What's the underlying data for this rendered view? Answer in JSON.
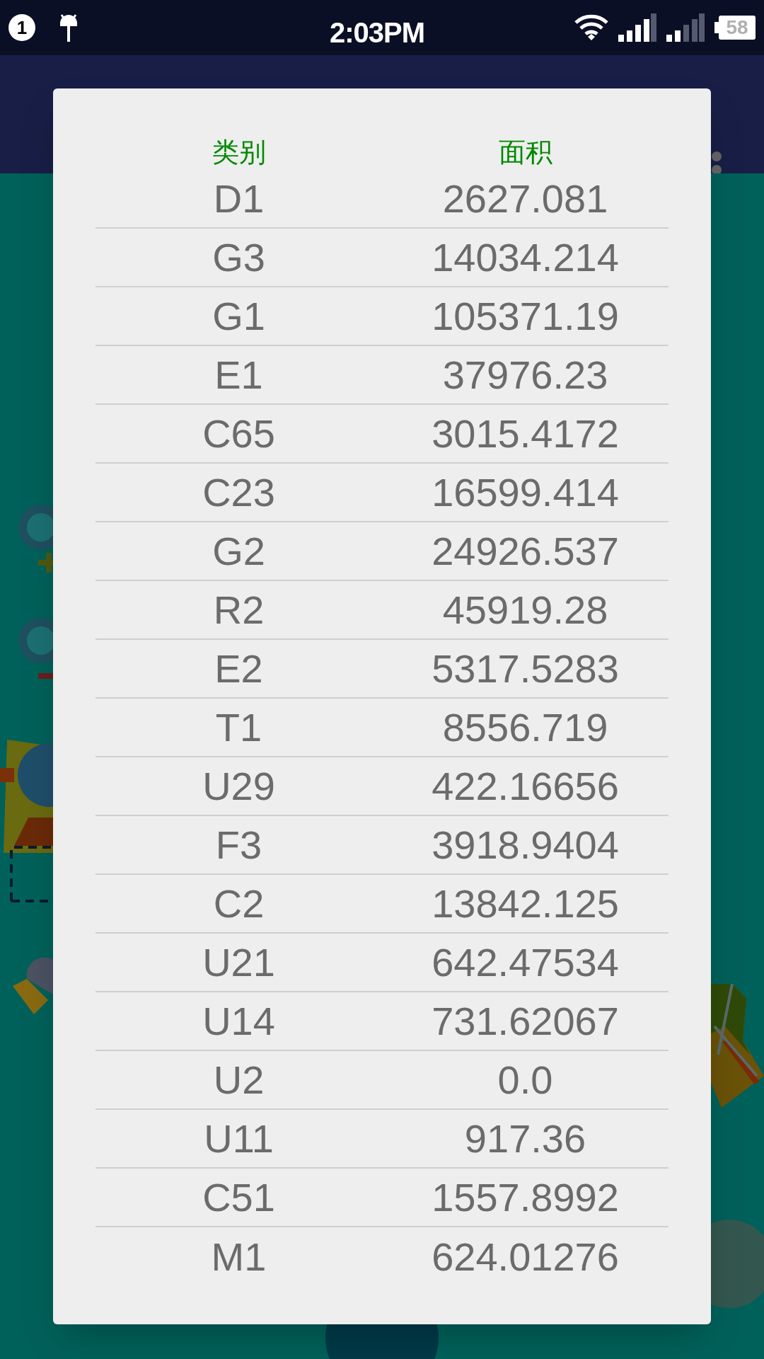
{
  "status_bar": {
    "notification_count": "1",
    "time": "2:03PM",
    "battery": "58"
  },
  "dialog": {
    "columns": [
      "类别",
      "面积"
    ],
    "rows": [
      {
        "category": "D1",
        "area": "2627.081"
      },
      {
        "category": "G3",
        "area": "14034.214"
      },
      {
        "category": "G1",
        "area": "105371.19"
      },
      {
        "category": "E1",
        "area": "37976.23"
      },
      {
        "category": "C65",
        "area": "3015.4172"
      },
      {
        "category": "C23",
        "area": "16599.414"
      },
      {
        "category": "G2",
        "area": "24926.537"
      },
      {
        "category": "R2",
        "area": "45919.28"
      },
      {
        "category": "E2",
        "area": "5317.5283"
      },
      {
        "category": "T1",
        "area": "8556.719"
      },
      {
        "category": "U29",
        "area": "422.16656"
      },
      {
        "category": "F3",
        "area": "3918.9404"
      },
      {
        "category": "C2",
        "area": "13842.125"
      },
      {
        "category": "U21",
        "area": "642.47534"
      },
      {
        "category": "U14",
        "area": "731.62067"
      },
      {
        "category": "U2",
        "area": "0.0"
      },
      {
        "category": "U11",
        "area": "917.36"
      },
      {
        "category": "C51",
        "area": "1557.8992"
      },
      {
        "category": "M1",
        "area": "624.01276"
      }
    ]
  }
}
